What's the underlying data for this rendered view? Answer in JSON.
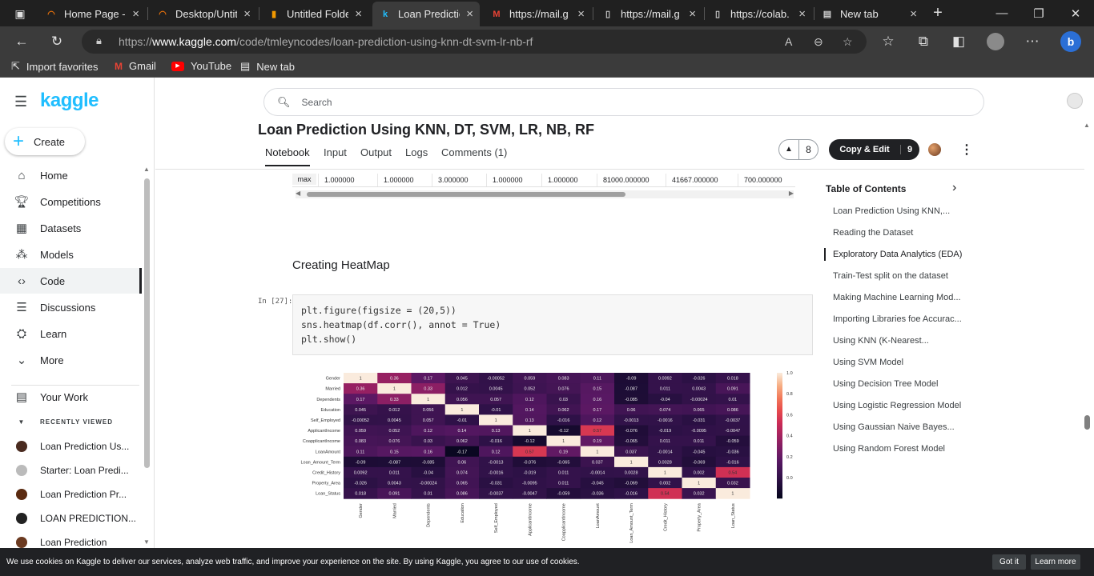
{
  "tabs": [
    {
      "title": "Home Page -",
      "icon": "spinner-icon",
      "color": "#e8710a"
    },
    {
      "title": "Desktop/Untit",
      "icon": "spinner-icon",
      "color": "#e8710a"
    },
    {
      "title": "Untitled Folde",
      "icon": "doc-orange-icon",
      "color": "#f29900"
    },
    {
      "title": "Loan Predictio",
      "icon": "kaggle-k-icon",
      "color": "#20beff"
    },
    {
      "title": "https://mail.g",
      "icon": "gmail-icon",
      "color": "#ea4335"
    },
    {
      "title": "https://mail.g",
      "icon": "page-icon",
      "color": "#ccc"
    },
    {
      "title": "https://colab.",
      "icon": "page-icon",
      "color": "#ccc"
    },
    {
      "title": "New tab",
      "icon": "newtab-icon",
      "color": "#ccc"
    }
  ],
  "address": {
    "prefix": "https://",
    "host": "www.kaggle.com",
    "path": "/code/tmleyncodes/loan-prediction-using-knn-dt-svm-lr-nb-rf"
  },
  "favorites": [
    {
      "label": "Import favorites"
    },
    {
      "label": "Gmail"
    },
    {
      "label": "YouTube"
    },
    {
      "label": "New tab"
    }
  ],
  "sidebar": {
    "logo": "kaggle",
    "create": "Create",
    "items": [
      {
        "label": "Home",
        "icon": "home-icon"
      },
      {
        "label": "Competitions",
        "icon": "trophy-icon"
      },
      {
        "label": "Datasets",
        "icon": "table-icon"
      },
      {
        "label": "Models",
        "icon": "models-icon"
      },
      {
        "label": "Code",
        "icon": "code-icon"
      },
      {
        "label": "Discussions",
        "icon": "chat-icon"
      },
      {
        "label": "Learn",
        "icon": "school-icon"
      },
      {
        "label": "More",
        "icon": "chevron-down-icon"
      }
    ],
    "your_work": "Your Work",
    "recent_header": "RECENTLY VIEWED",
    "recent": [
      {
        "label": "Loan Prediction Us...",
        "color": "#4a2b20"
      },
      {
        "label": "Starter: Loan Predi...",
        "color": "#bbbbbb"
      },
      {
        "label": "Loan Prediction Pr...",
        "color": "#5a2a10"
      },
      {
        "label": "LOAN PREDICTION...",
        "color": "#222222"
      },
      {
        "label": "Loan Prediction",
        "color": "#6b3a20"
      }
    ]
  },
  "search": {
    "placeholder": "Search"
  },
  "notebook": {
    "title": "Loan Prediction Using KNN, DT, SVM, LR, NB, RF",
    "tabs": [
      "Notebook",
      "Input",
      "Output",
      "Logs",
      "Comments (1)"
    ],
    "upvotes": "8",
    "copy_edit": "Copy & Edit",
    "copies": "9"
  },
  "max_row": [
    "max",
    "1.000000",
    "1.000000",
    "3.000000",
    "1.000000",
    "1.000000",
    "81000.000000",
    "41667.000000",
    "700.000000"
  ],
  "section_heading": "Creating HeatMap",
  "cell_prompt": "In [27]:",
  "code_lines": [
    "plt.figure(figsize = (20,5))",
    "sns.heatmap(df.corr(), annot = True)",
    "plt.show()"
  ],
  "toc": {
    "title": "Table of Contents",
    "items": [
      "Loan Prediction Using KNN,...",
      "Reading the Dataset",
      "Exploratory Data Analytics (EDA)",
      "Train-Test split on the dataset",
      "Making Machine Learning Mod...",
      "Importing Libraries foe Accurac...",
      "Using KNN (K-Nearest...",
      "Using SVM Model",
      "Using Decision Tree Model",
      "Using Logistic Regression Model",
      "Using Gaussian Naive Bayes...",
      "Using Random Forest Model"
    ],
    "active": 2
  },
  "cookie": {
    "text": "We use cookies on Kaggle to deliver our services, analyze web traffic, and improve your experience on the site. By using Kaggle, you agree to our use of cookies.",
    "got_it": "Got it",
    "learn_more": "Learn more"
  },
  "chart_data": {
    "type": "heatmap",
    "labels": [
      "Gender",
      "Married",
      "Dependents",
      "Education",
      "Self_Employed",
      "ApplicantIncome",
      "CoapplicantIncome",
      "LoanAmount",
      "Loan_Amount_Term",
      "Credit_History",
      "Property_Area",
      "Loan_Status"
    ],
    "colorbar_ticks": [
      "1.0",
      "0.8",
      "0.6",
      "0.4",
      "0.2",
      "0.0"
    ],
    "vmin": -0.2,
    "vmax": 1.0,
    "values": [
      [
        1,
        0.36,
        0.17,
        0.045,
        -0.00052,
        0.059,
        0.083,
        0.11,
        -0.09,
        0.0092,
        -0.026,
        0.018
      ],
      [
        0.36,
        1,
        0.33,
        0.012,
        0.0045,
        0.052,
        0.076,
        0.15,
        -0.087,
        0.011,
        0.0043,
        0.091
      ],
      [
        0.17,
        0.33,
        1,
        0.056,
        0.057,
        0.12,
        0.03,
        0.16,
        -0.085,
        -0.04,
        -0.00024,
        0.01
      ],
      [
        0.045,
        0.012,
        0.056,
        1,
        -0.01,
        0.14,
        0.062,
        0.17,
        0.06,
        0.074,
        0.065,
        0.086
      ],
      [
        -0.00052,
        0.0045,
        0.057,
        -0.01,
        1,
        0.13,
        -0.016,
        0.12,
        -0.0013,
        -0.0016,
        -0.031,
        -0.0037
      ],
      [
        0.059,
        0.052,
        0.12,
        0.14,
        0.13,
        1,
        -0.12,
        0.57,
        -0.076,
        -0.019,
        -0.0095,
        -0.0047
      ],
      [
        0.083,
        0.076,
        0.03,
        0.062,
        -0.016,
        -0.12,
        1,
        0.19,
        -0.065,
        0.011,
        0.011,
        -0.059
      ],
      [
        0.11,
        0.15,
        0.16,
        -0.17,
        0.12,
        0.57,
        0.19,
        1,
        0.037,
        -0.0014,
        -0.045,
        -0.036
      ],
      [
        -0.09,
        -0.087,
        -0.085,
        0.06,
        -0.0013,
        -0.076,
        -0.065,
        0.037,
        1,
        0.0028,
        -0.069,
        -0.016
      ],
      [
        0.0092,
        0.011,
        -0.04,
        0.074,
        -0.0016,
        -0.019,
        0.011,
        -0.0014,
        0.0028,
        1,
        0.002,
        0.54
      ],
      [
        -0.026,
        0.0043,
        -0.00024,
        0.065,
        -0.031,
        -0.0095,
        0.011,
        -0.045,
        -0.069,
        0.002,
        1,
        0.032
      ],
      [
        0.018,
        0.091,
        0.01,
        0.086,
        -0.0037,
        -0.0047,
        -0.059,
        -0.036,
        -0.016,
        0.54,
        0.032,
        1
      ]
    ]
  }
}
